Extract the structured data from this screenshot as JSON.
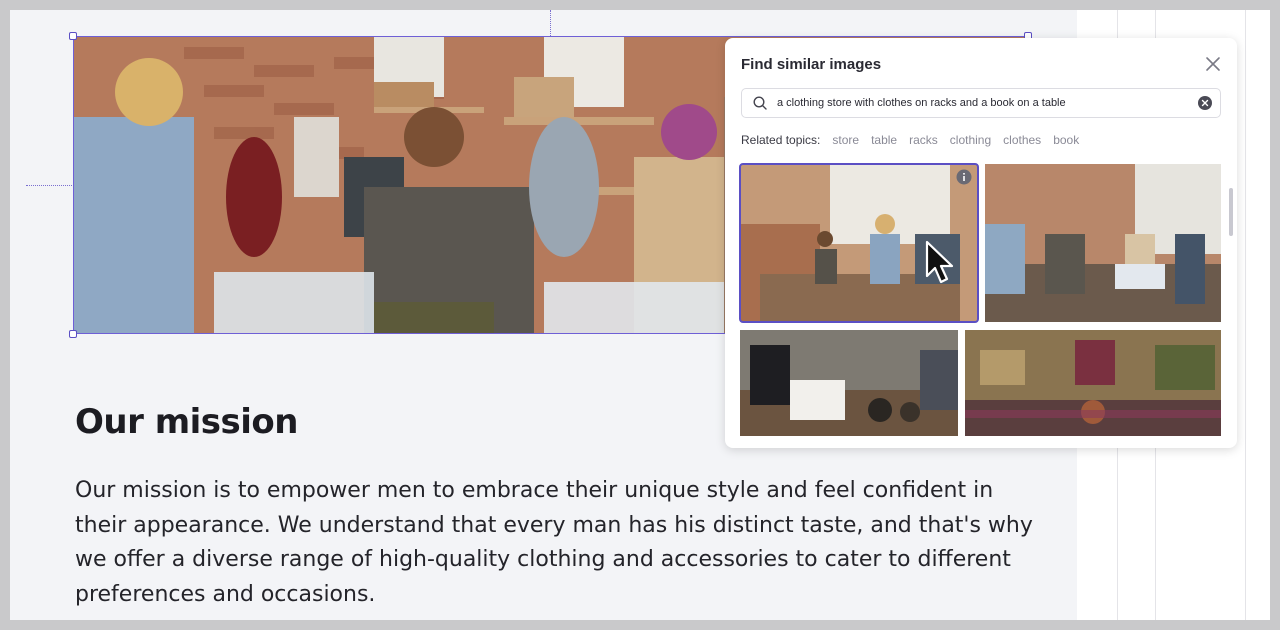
{
  "main": {
    "heading": "Our mission",
    "paragraph": "Our mission is to empower men to embrace their unique style and feel confident in their appearance. We understand that every man has his distinct taste, and that's why we offer a diverse range of high-quality clothing and accessories to cater to different preferences and occasions."
  },
  "popup": {
    "title": "Find similar images",
    "search_value": "a clothing store with clothes on racks and a book on a table",
    "related_label": "Related topics:",
    "topics": [
      "store",
      "table",
      "racks",
      "clothing",
      "clothes",
      "book"
    ]
  },
  "icons": {
    "close": "close-icon",
    "search": "search-icon",
    "clear": "clear-circle-icon",
    "info": "info-icon",
    "cursor": "mouse-pointer-icon"
  },
  "colors": {
    "selection": "#6e5fd6",
    "canvas": "#f3f4f7",
    "text": "#24242a"
  }
}
